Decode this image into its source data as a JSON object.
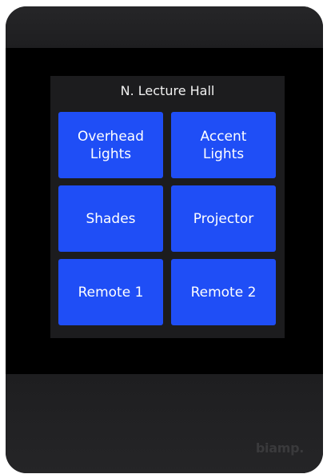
{
  "panel": {
    "title": "N. Lecture Hall"
  },
  "buttons": [
    {
      "label": "Overhead\nLights"
    },
    {
      "label": "Accent\nLights"
    },
    {
      "label": "Shades"
    },
    {
      "label": "Projector"
    },
    {
      "label": "Remote 1"
    },
    {
      "label": "Remote 2"
    }
  ],
  "branding": {
    "logo_text": "biamp."
  },
  "colors": {
    "button": "#1f4ef6",
    "device": "#1d1d1f",
    "screen": "#000000",
    "panel": "#1c1c1e"
  }
}
